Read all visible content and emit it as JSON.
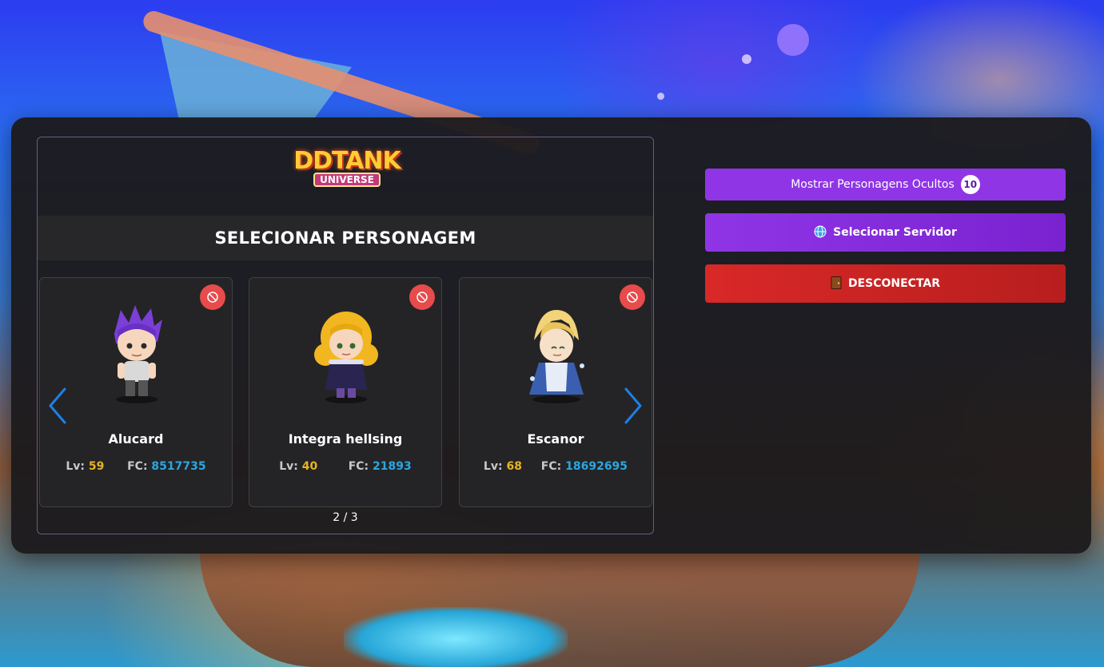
{
  "logo": {
    "main": "DDTANK",
    "sub": "UNIVERSE"
  },
  "title": "SELECIONAR PERSONAGEM",
  "characters": [
    {
      "name": "Alucard",
      "lv_label": "Lv:",
      "lv": "59",
      "fc_label": "FC:",
      "fc": "8517735",
      "hair_color": "#7a3fd6",
      "outfit_color": "#d9d9d9"
    },
    {
      "name": "Integra hellsing",
      "lv_label": "Lv:",
      "lv": "40",
      "fc_label": "FC:",
      "fc": "21893",
      "hair_color": "#f2b720",
      "outfit_color": "#2a2450"
    },
    {
      "name": "Escanor",
      "lv_label": "Lv:",
      "lv": "68",
      "fc_label": "FC:",
      "fc": "18692695",
      "hair_color": "#f2d37a",
      "outfit_color": "#3a5fb0"
    }
  ],
  "pagination": "2 / 3",
  "buttons": {
    "show_hidden": "Mostrar Personagens Ocultos",
    "hidden_count": "10",
    "select_server": "Selecionar Servidor",
    "server_icon": "globe-icon",
    "disconnect": "DESCONECTAR",
    "disconnect_icon": "door-icon"
  },
  "colors": {
    "accent_purple": "#8f35e6",
    "danger_red": "#d92828",
    "level_gold": "#e8b422",
    "fc_blue": "#2ca6e0",
    "arrow_blue": "#1f7fe6"
  }
}
